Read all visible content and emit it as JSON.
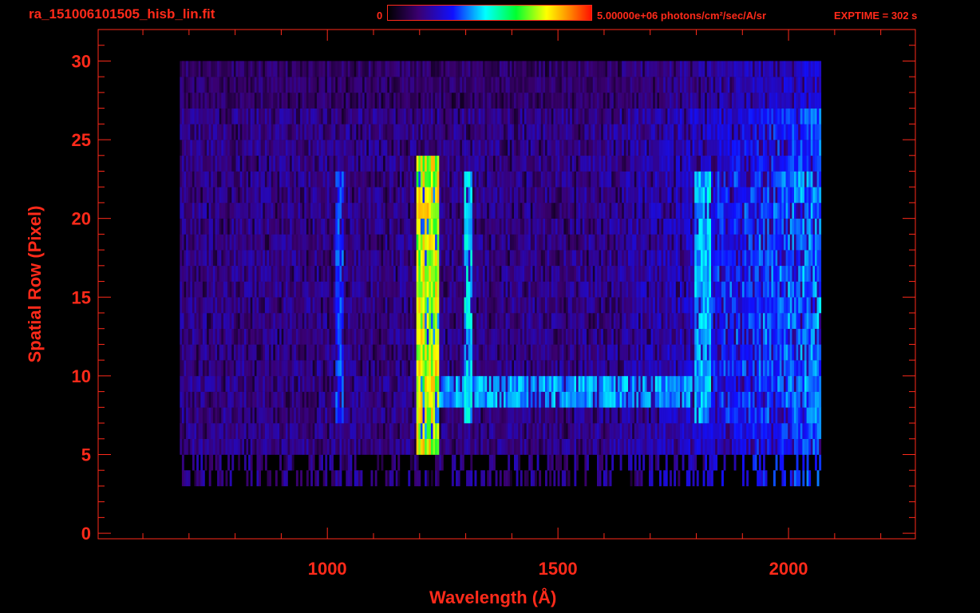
{
  "header": {
    "title": "ra_151006101505_hisb_lin.fit",
    "colorbar_min": "0",
    "colorbar_max": "5.00000e+06 photons/cm²/sec/A/sr",
    "exptime": "EXPTIME = 302 s"
  },
  "colors": {
    "axis": "#ff2a1a",
    "background": "#000000"
  },
  "chart_data": {
    "type": "heatmap",
    "title": "ra_151006101505_hisb_lin.fit",
    "xlabel": "Wavelength (Å)",
    "ylabel": "Spatial Row (Pixel)",
    "xlim": [
      503,
      2275
    ],
    "ylim": [
      -0.35,
      32
    ],
    "xticks": [
      1000,
      1500,
      2000
    ],
    "xtick_labels": [
      "1000",
      "1500",
      "2000"
    ],
    "yticks": [
      0,
      5,
      10,
      15,
      20,
      25,
      30
    ],
    "ytick_labels": [
      "0",
      "5",
      "10",
      "15",
      "20",
      "25",
      "30"
    ],
    "colorbar_range": [
      0,
      5000000
    ],
    "data_extent": {
      "wavelength": [
        680,
        2070
      ],
      "rows": [
        3,
        30
      ]
    },
    "emission_lines": [
      {
        "wavelength": 1025,
        "rows": [
          7,
          23
        ],
        "strength": 0.35
      },
      {
        "wavelength": 1216,
        "rows": [
          5,
          24
        ],
        "strength": 0.75
      },
      {
        "wavelength": 1304,
        "rows": [
          7,
          23
        ],
        "strength": 0.45
      },
      {
        "wavelength": 1810,
        "rows": [
          7,
          23
        ],
        "strength": 0.42
      }
    ],
    "bright_rows": {
      "rows": [
        8,
        9
      ],
      "wavelength": [
        1200,
        1790
      ]
    }
  }
}
